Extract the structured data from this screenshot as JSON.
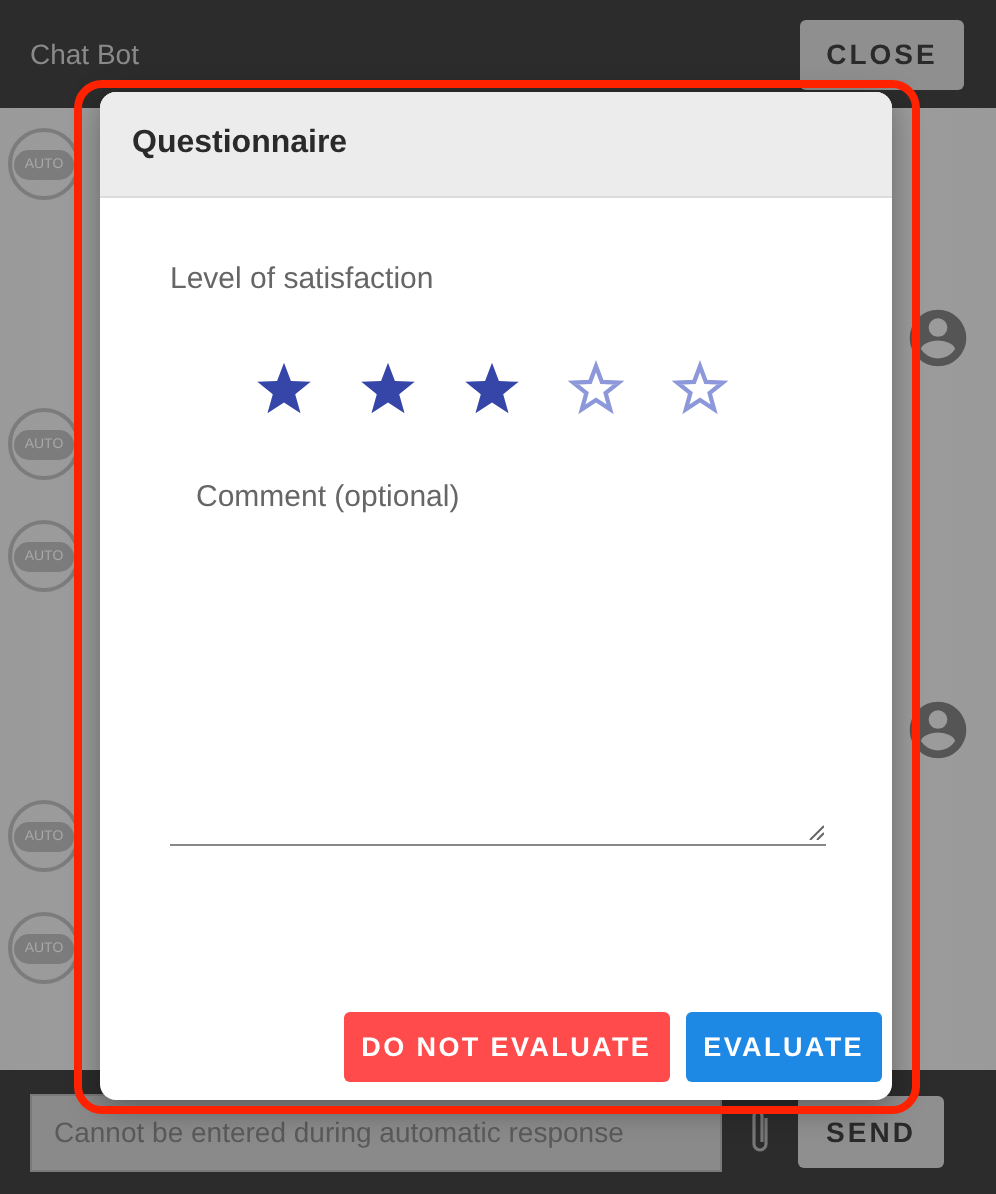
{
  "window": {
    "title": "Chat Bot",
    "close_button": "CLOSE"
  },
  "messages": [
    {
      "kind": "bot",
      "avatar_label": "AUTO"
    },
    {
      "kind": "user"
    },
    {
      "kind": "bot",
      "avatar_label": "AUTO"
    },
    {
      "kind": "bot",
      "avatar_label": "AUTO"
    },
    {
      "kind": "user"
    },
    {
      "kind": "bot",
      "avatar_label": "AUTO"
    },
    {
      "kind": "bot",
      "avatar_label": "AUTO"
    }
  ],
  "composer": {
    "placeholder": "Cannot be entered during automatic response",
    "send_button": "SEND"
  },
  "dialog": {
    "title": "Questionnaire",
    "highlighted": true,
    "rating_label": "Level of satisfaction",
    "rating": {
      "stars": 3
    },
    "comment": {
      "placeholder": "Comment (optional)"
    },
    "buttons": [
      {
        "label": "DO NOT EVALUATE",
        "kind": "secondary"
      },
      {
        "label": "EVALUATE",
        "kind": "primary"
      }
    ]
  }
}
